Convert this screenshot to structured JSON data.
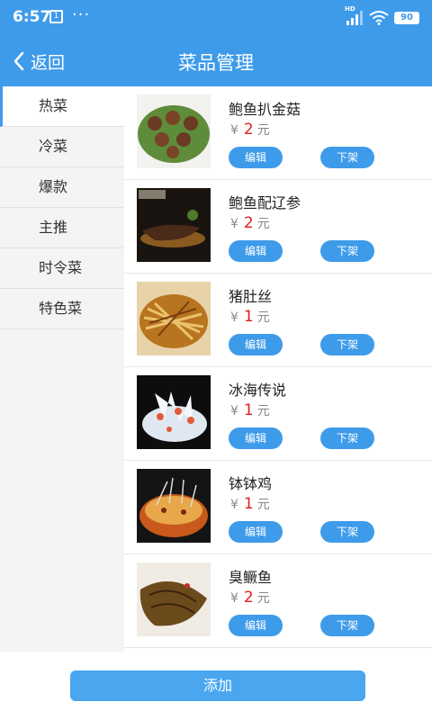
{
  "status_bar": {
    "time": "6:57",
    "calendar_day": "1",
    "dots": "···",
    "hd_label": "HD",
    "battery": "90"
  },
  "header": {
    "back_label": "返回",
    "title": "菜品管理"
  },
  "sidebar": {
    "items": [
      {
        "label": "热菜",
        "active": true
      },
      {
        "label": "冷菜"
      },
      {
        "label": "爆款"
      },
      {
        "label": "主推"
      },
      {
        "label": "时令菜"
      },
      {
        "label": "特色菜"
      }
    ]
  },
  "dishes": [
    {
      "name": "鲍鱼扒金菇",
      "currency": "¥",
      "price": "2",
      "unit": "元",
      "edit_label": "编辑",
      "off_label": "下架"
    },
    {
      "name": "鲍鱼配辽参",
      "currency": "¥",
      "price": "2",
      "unit": "元",
      "edit_label": "编辑",
      "off_label": "下架"
    },
    {
      "name": "猪肚丝",
      "currency": "¥",
      "price": "1",
      "unit": "元",
      "edit_label": "编辑",
      "off_label": "下架"
    },
    {
      "name": "冰海传说",
      "currency": "¥",
      "price": "1",
      "unit": "元",
      "edit_label": "编辑",
      "off_label": "下架"
    },
    {
      "name": "钵钵鸡",
      "currency": "¥",
      "price": "1",
      "unit": "元",
      "edit_label": "编辑",
      "off_label": "下架"
    },
    {
      "name": "臭鳜鱼",
      "currency": "¥",
      "price": "2",
      "unit": "元",
      "edit_label": "编辑",
      "off_label": "下架"
    }
  ],
  "footer": {
    "add_label": "添加"
  },
  "colors": {
    "primary": "#3e9bea",
    "price_red": "#e02020"
  }
}
